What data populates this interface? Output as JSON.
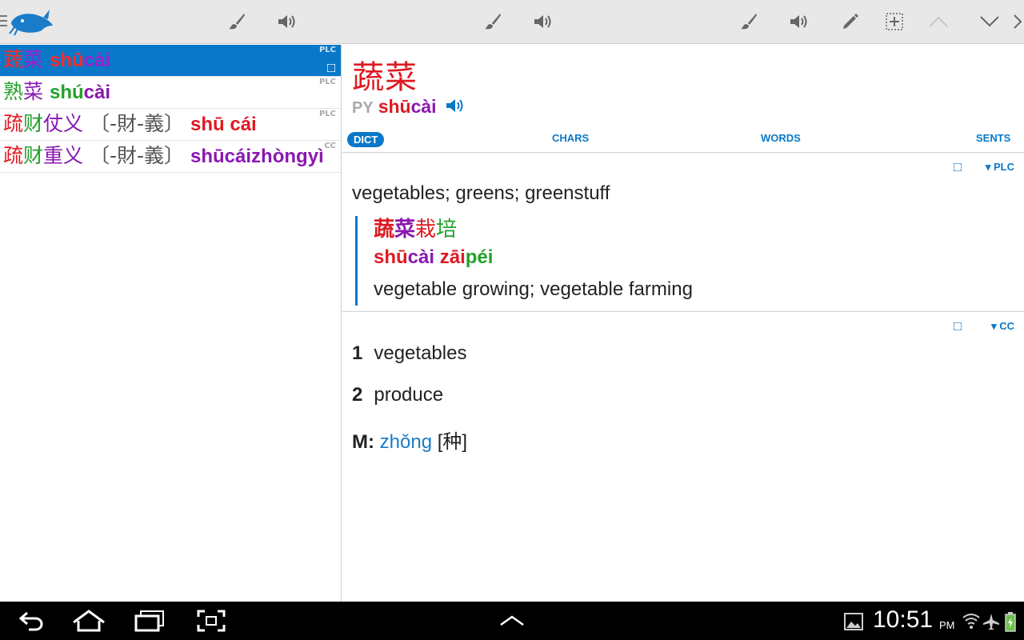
{
  "toolbar": {
    "icons": [
      "menu-icon",
      "app-logo",
      "brush-icon",
      "speaker-icon",
      "brush-icon",
      "speaker-icon",
      "brush-icon",
      "speaker-icon",
      "pencil-icon",
      "grid-select-icon",
      "chevron-up-icon",
      "chevron-down-icon",
      "chevron-right-icon"
    ]
  },
  "results": [
    {
      "hanzi": [
        "蔬",
        "菜"
      ],
      "pinyin": [
        "shū",
        "cài"
      ],
      "source": "PLC",
      "selected": true
    },
    {
      "hanzi": [
        "熟",
        "菜"
      ],
      "pinyin": [
        "shú",
        "cài"
      ],
      "source": "PLC",
      "selected": false
    },
    {
      "hanzi": [
        "疏",
        "财",
        "仗",
        "义"
      ],
      "trad": "〔-財-義〕",
      "pinyin": "shū cái",
      "source": "PLC",
      "selected": false
    },
    {
      "hanzi": [
        "疏",
        "财",
        "重",
        "义"
      ],
      "trad": "〔-財-義〕",
      "pinyin": "shūcáizhòngyì",
      "source": "CC",
      "selected": false
    }
  ],
  "entry": {
    "headword": "蔬菜",
    "py_label": "PY",
    "pinyin_1": "shū",
    "pinyin_2": "cài"
  },
  "tabs": {
    "dict": "DICT",
    "chars": "CHARS",
    "words": "WORDS",
    "sents": "SENTS"
  },
  "plc": {
    "source_label": "▾ PLC",
    "definition": "vegetables; greens; greenstuff",
    "example": {
      "hanzi": "蔬菜栽培",
      "pinyin": "shūcài zāipéi",
      "english": "vegetable growing; vegetable farming"
    }
  },
  "cc": {
    "source_label": "▾ CC",
    "senses": [
      {
        "num": "1",
        "text": "vegetables"
      },
      {
        "num": "2",
        "text": "produce"
      }
    ],
    "measure_label": "M:",
    "measure_pinyin": "zhǒng",
    "measure_hanzi": "[种]"
  },
  "status": {
    "time": "10:51",
    "ampm": "PM"
  },
  "colors": {
    "accent": "#0a78c8",
    "tone1": "#dd1a22",
    "tone2": "#22a22a",
    "tone4": "#8a18b0"
  }
}
